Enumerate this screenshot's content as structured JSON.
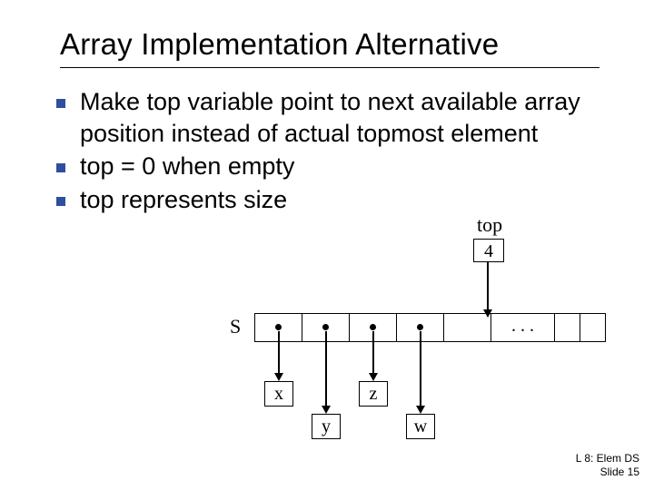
{
  "title": "Array Implementation Alternative",
  "bullets": [
    "Make top variable point to next available array position instead of actual topmost element",
    "top = 0 when empty",
    "top represents size"
  ],
  "diagram": {
    "top_label": "top",
    "top_value": "4",
    "array_label": "S",
    "ellipsis": ". . .",
    "elements": [
      "x",
      "y",
      "z",
      "w"
    ]
  },
  "footer": {
    "line1": "L 8: Elem DS",
    "line2": "Slide 15"
  }
}
